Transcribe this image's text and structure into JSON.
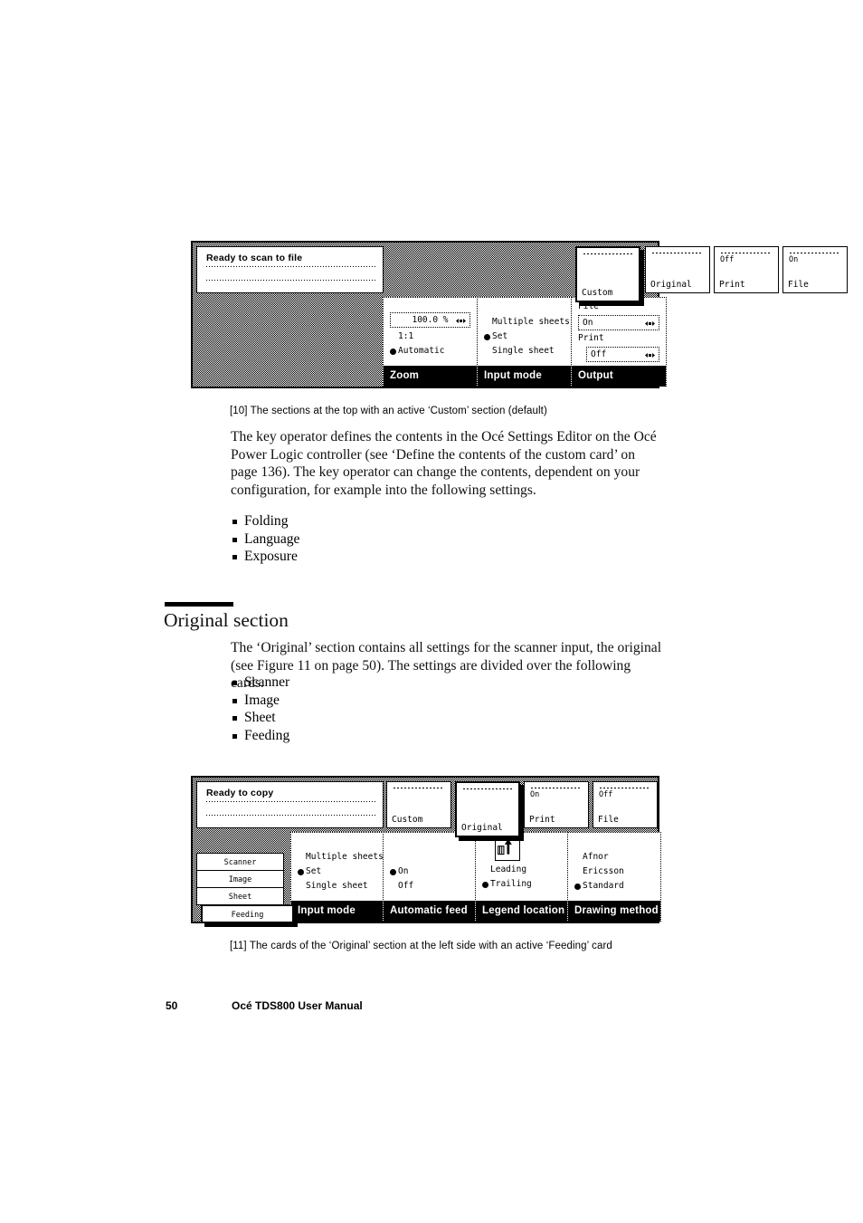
{
  "page": {
    "folio_number": "50",
    "folio_title": "Océ TDS800 User Manual"
  },
  "figure10": {
    "caption": "[10] The sections at the top with an active ‘Custom’ section (default)",
    "display": {
      "status": "Ready to scan to file"
    },
    "tabs": [
      {
        "name": "custom",
        "label": "Custom",
        "status": "",
        "active": true
      },
      {
        "name": "original",
        "label": "Original",
        "status": "",
        "active": false
      },
      {
        "name": "print",
        "label": "Print",
        "status": "Off",
        "active": false
      },
      {
        "name": "file",
        "label": "File",
        "status": "On",
        "active": false
      }
    ],
    "cards": [
      {
        "title": "Zoom",
        "value": "100.0 %",
        "value_has_spinner": true,
        "options": [
          {
            "label": "1:1",
            "selected": false
          },
          {
            "label": "Automatic",
            "selected": true
          }
        ]
      },
      {
        "title": "Input mode",
        "options": [
          {
            "label": "Multiple sheets",
            "selected": false
          },
          {
            "label": "Set",
            "selected": true
          },
          {
            "label": "Single sheet",
            "selected": false
          }
        ]
      },
      {
        "title": "Output",
        "groups": [
          {
            "label": "File",
            "value": "On",
            "value_has_spinner": true,
            "selected": false
          },
          {
            "label": "Print",
            "value": "Off",
            "value_has_spinner": true,
            "selected": true
          }
        ]
      }
    ]
  },
  "body1": {
    "paragraph": "The key operator defines the contents in the Océ Settings Editor on the Océ Power Logic controller (see ‘Define the contents of the custom card’ on page 136). The key operator can change the contents, dependent on your configuration, for example into the following settings.",
    "bullets": [
      "Folding",
      "Language",
      "Exposure"
    ]
  },
  "section": {
    "heading": "Original section",
    "paragraph": "The ‘Original’ section contains all settings for the scanner input, the original (see Figure 11 on page 50). The settings are divided over the following cards.",
    "bullets": [
      "Scanner",
      "Image",
      "Sheet",
      "Feeding"
    ]
  },
  "figure11": {
    "caption": "[11] The cards of the ‘Original’ section at the left side with an active ‘Feeding’ card",
    "display": {
      "status": "Ready to copy"
    },
    "tabs": [
      {
        "name": "custom",
        "label": "Custom",
        "status": "",
        "active": false
      },
      {
        "name": "original",
        "label": "Original",
        "status": "",
        "active": true
      },
      {
        "name": "print",
        "label": "Print",
        "status": "On",
        "active": false
      },
      {
        "name": "file",
        "label": "File",
        "status": "Off",
        "active": false
      }
    ],
    "sidecards": [
      {
        "label": "Scanner",
        "active": false
      },
      {
        "label": "Image",
        "active": false
      },
      {
        "label": "Sheet",
        "active": false
      },
      {
        "label": "Feeding",
        "active": true
      }
    ],
    "cards": [
      {
        "title": "Input mode",
        "options": [
          {
            "label": "Multiple sheets",
            "selected": false
          },
          {
            "label": "Set",
            "selected": true
          },
          {
            "label": "Single sheet",
            "selected": false
          }
        ]
      },
      {
        "title": "Automatic feed",
        "options": [
          {
            "label": "On",
            "selected": true
          },
          {
            "label": "Off",
            "selected": false
          }
        ]
      },
      {
        "title": "Legend location",
        "icon": "legend-arrow-icon",
        "options": [
          {
            "label": "Leading",
            "selected": false
          },
          {
            "label": "Trailing",
            "selected": true
          }
        ]
      },
      {
        "title": "Drawing method",
        "options": [
          {
            "label": "Afnor",
            "selected": false
          },
          {
            "label": "Ericsson",
            "selected": false
          },
          {
            "label": "Standard",
            "selected": true
          }
        ]
      }
    ]
  }
}
